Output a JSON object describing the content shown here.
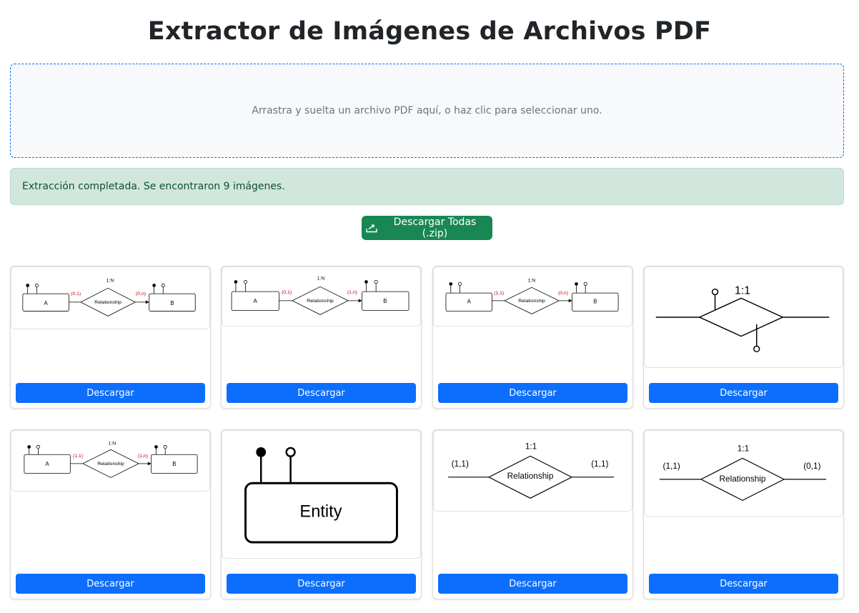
{
  "page": {
    "title": "Extractor de Imágenes de Archivos PDF"
  },
  "dropzone": {
    "text": "Arrastra y suelta un archivo PDF aquí, o haz clic para seleccionar uno."
  },
  "alert": {
    "text": "Extracción completada. Se encontraron 9 imágenes.",
    "color": "#d1e7dd"
  },
  "download_all": {
    "label": "Descargar Todas (.zip)",
    "icon": "download-tray-icon",
    "color": "#198754"
  },
  "cards": [
    {
      "download_label": "Descargar",
      "diagram": {
        "cardinality": "1:N",
        "left_label": "(0,1)",
        "right_label": "(0,n)",
        "relationship": "Relationship",
        "entity_a": "A",
        "entity_b": "B"
      }
    },
    {
      "download_label": "Descargar",
      "diagram": {
        "cardinality": "1:N",
        "left_label": "(0,1)",
        "right_label": "(1,n)",
        "relationship": "Relationship",
        "entity_a": "A",
        "entity_b": "B"
      }
    },
    {
      "download_label": "Descargar",
      "diagram": {
        "cardinality": "1:N",
        "left_label": "(1,1)",
        "right_label": "(0,n)",
        "relationship": "Relationship",
        "entity_a": "A",
        "entity_b": "B"
      }
    },
    {
      "download_label": "Descargar",
      "diagram": {
        "cardinality": "1:1"
      }
    },
    {
      "download_label": "Descargar",
      "diagram": {
        "cardinality": "1:N",
        "left_label": "(1,1)",
        "right_label": "(1,n)",
        "relationship": "Relationship",
        "entity_a": "A",
        "entity_b": "B"
      }
    },
    {
      "download_label": "Descargar",
      "diagram": {
        "entity": "Entity"
      }
    },
    {
      "download_label": "Descargar",
      "diagram": {
        "cardinality": "1:1",
        "left_label": "(1,1)",
        "right_label": "(1,1)",
        "relationship": "Relationship"
      }
    },
    {
      "download_label": "Descargar",
      "diagram": {
        "cardinality": "1:1",
        "left_label": "(1,1)",
        "right_label": "(0,1)",
        "relationship": "Relationship"
      }
    }
  ]
}
